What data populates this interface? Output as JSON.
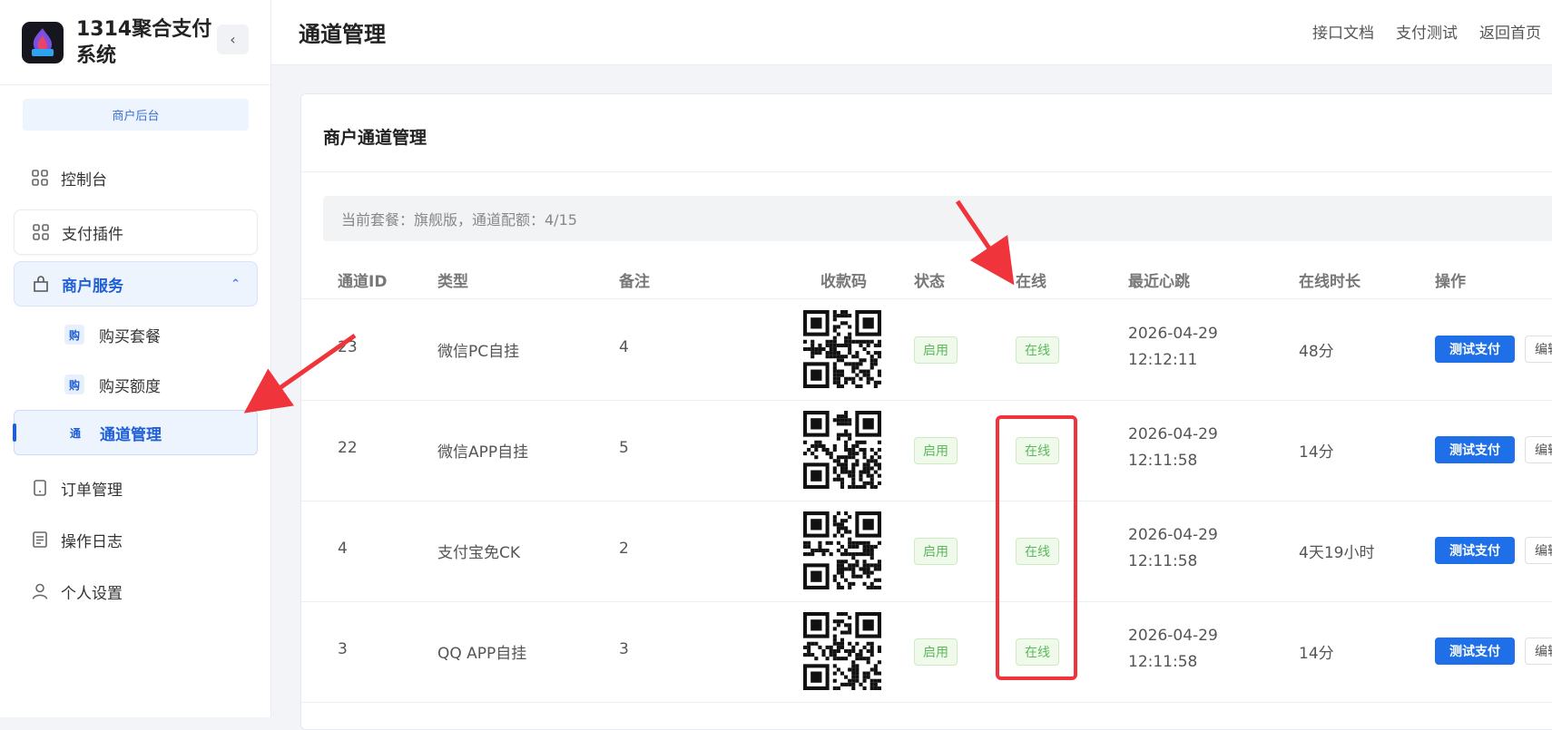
{
  "sidebar": {
    "brand_title": "1314聚合支付系统",
    "logo_text": "1314",
    "collapse_icon": "chevron-left-icon",
    "merchant_tag": "商户后台",
    "menu": [
      {
        "label": "控制台",
        "icon": "grid-icon"
      },
      {
        "label": "支付插件",
        "icon": "grid-icon"
      },
      {
        "label": "商户服务",
        "icon": "bag-icon",
        "expanded": true
      },
      {
        "label": "订单管理",
        "icon": "tablet-icon"
      },
      {
        "label": "操作日志",
        "icon": "doc-icon"
      },
      {
        "label": "个人设置",
        "icon": "user-icon"
      }
    ],
    "submenu": [
      {
        "badge": "购",
        "label": "购买套餐"
      },
      {
        "badge": "购",
        "label": "购买额度"
      },
      {
        "badge": "通",
        "label": "通道管理",
        "active": true
      }
    ]
  },
  "header": {
    "title": "通道管理",
    "links": [
      "接口文档",
      "支付测试",
      "返回首页"
    ]
  },
  "card": {
    "title": "商户通道管理",
    "quota": "当前套餐：旗舰版，通道配额：4/15"
  },
  "table": {
    "columns": [
      "通道ID",
      "类型",
      "备注",
      "收款码",
      "状态",
      "在线",
      "最近心跳",
      "在线时长",
      "操作"
    ],
    "rows": [
      {
        "id": "23",
        "type": "微信PC自挂",
        "note": "4",
        "status": "启用",
        "online": "在线",
        "hb_date": "2026-04-29",
        "hb_time": "12:12:11",
        "duration": "48分",
        "test": "测试支付",
        "edit": "编辑"
      },
      {
        "id": "22",
        "type": "微信APP自挂",
        "note": "5",
        "status": "启用",
        "online": "在线",
        "hb_date": "2026-04-29",
        "hb_time": "12:11:58",
        "duration": "14分",
        "test": "测试支付",
        "edit": "编辑"
      },
      {
        "id": "4",
        "type": "支付宝免CK",
        "note": "2",
        "status": "启用",
        "online": "在线",
        "hb_date": "2026-04-29",
        "hb_time": "12:11:58",
        "duration": "4天19小时",
        "test": "测试支付",
        "edit": "编辑"
      },
      {
        "id": "3",
        "type": "QQ APP自挂",
        "note": "3",
        "status": "启用",
        "online": "在线",
        "hb_date": "2026-04-29",
        "hb_time": "12:11:58",
        "duration": "14分",
        "test": "测试支付",
        "edit": "编辑"
      }
    ]
  },
  "colors": {
    "primary": "#1f6fe8",
    "success": "#5cb85c",
    "annotation": "#f0343b"
  }
}
